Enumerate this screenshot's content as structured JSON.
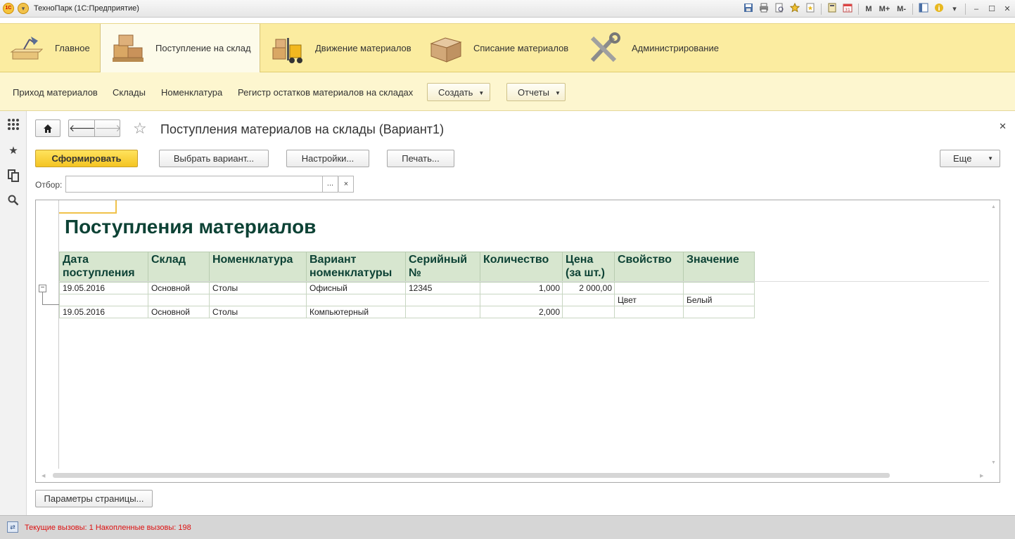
{
  "window": {
    "title": "ТехноПарк  (1С:Предприятие)",
    "toolbar_m": [
      "M",
      "M+",
      "M-"
    ]
  },
  "sections": [
    {
      "label": "Главное",
      "icon": "desk-lamp-icon"
    },
    {
      "label": "Поступление на склад",
      "icon": "boxes-on-pallet-icon",
      "active": true
    },
    {
      "label": "Движение материалов",
      "icon": "forklift-icon"
    },
    {
      "label": "Списание материалов",
      "icon": "crate-icon"
    },
    {
      "label": "Администрирование",
      "icon": "tools-icon"
    }
  ],
  "commands": {
    "links": [
      "Приход материалов",
      "Склады",
      "Номенклатура",
      "Регистр остатков материалов на складах"
    ],
    "create_label": "Создать",
    "reports_label": "Отчеты"
  },
  "form": {
    "title": "Поступления материалов на склады (Вариант1)",
    "buttons": {
      "generate": "Сформировать",
      "choose_variant": "Выбрать вариант...",
      "settings": "Настройки...",
      "print": "Печать...",
      "more": "Еще"
    },
    "filter": {
      "label": "Отбор:",
      "value": "",
      "pick": "...",
      "clear": "×"
    },
    "page_params": "Параметры страницы..."
  },
  "report": {
    "title": "Поступления материалов",
    "columns": [
      {
        "line1": "Дата",
        "line2": "поступления"
      },
      {
        "line1": "Склад",
        "line2": ""
      },
      {
        "line1": "Номенклатура",
        "line2": ""
      },
      {
        "line1": "Вариант",
        "line2": "номенклатуры"
      },
      {
        "line1": "Серийный",
        "line2": "№"
      },
      {
        "line1": "Количество",
        "line2": ""
      },
      {
        "line1": "Цена",
        "line2": "(за шт.)"
      },
      {
        "line1": "Свойство",
        "line2": ""
      },
      {
        "line1": "Значение",
        "line2": ""
      }
    ],
    "rows": [
      [
        "19.05.2016",
        "Основной",
        "Столы",
        "Офисный",
        "12345",
        "1,000",
        "2 000,00",
        "",
        ""
      ],
      [
        "",
        "",
        "",
        "",
        "",
        "",
        "",
        "Цвет",
        "Белый"
      ],
      [
        "19.05.2016",
        "Основной",
        "Столы",
        "Компьютерный",
        "",
        "2,000",
        "",
        "",
        ""
      ]
    ]
  },
  "status": {
    "text": "Текущие вызовы: 1   Накопленные вызовы: 198"
  }
}
